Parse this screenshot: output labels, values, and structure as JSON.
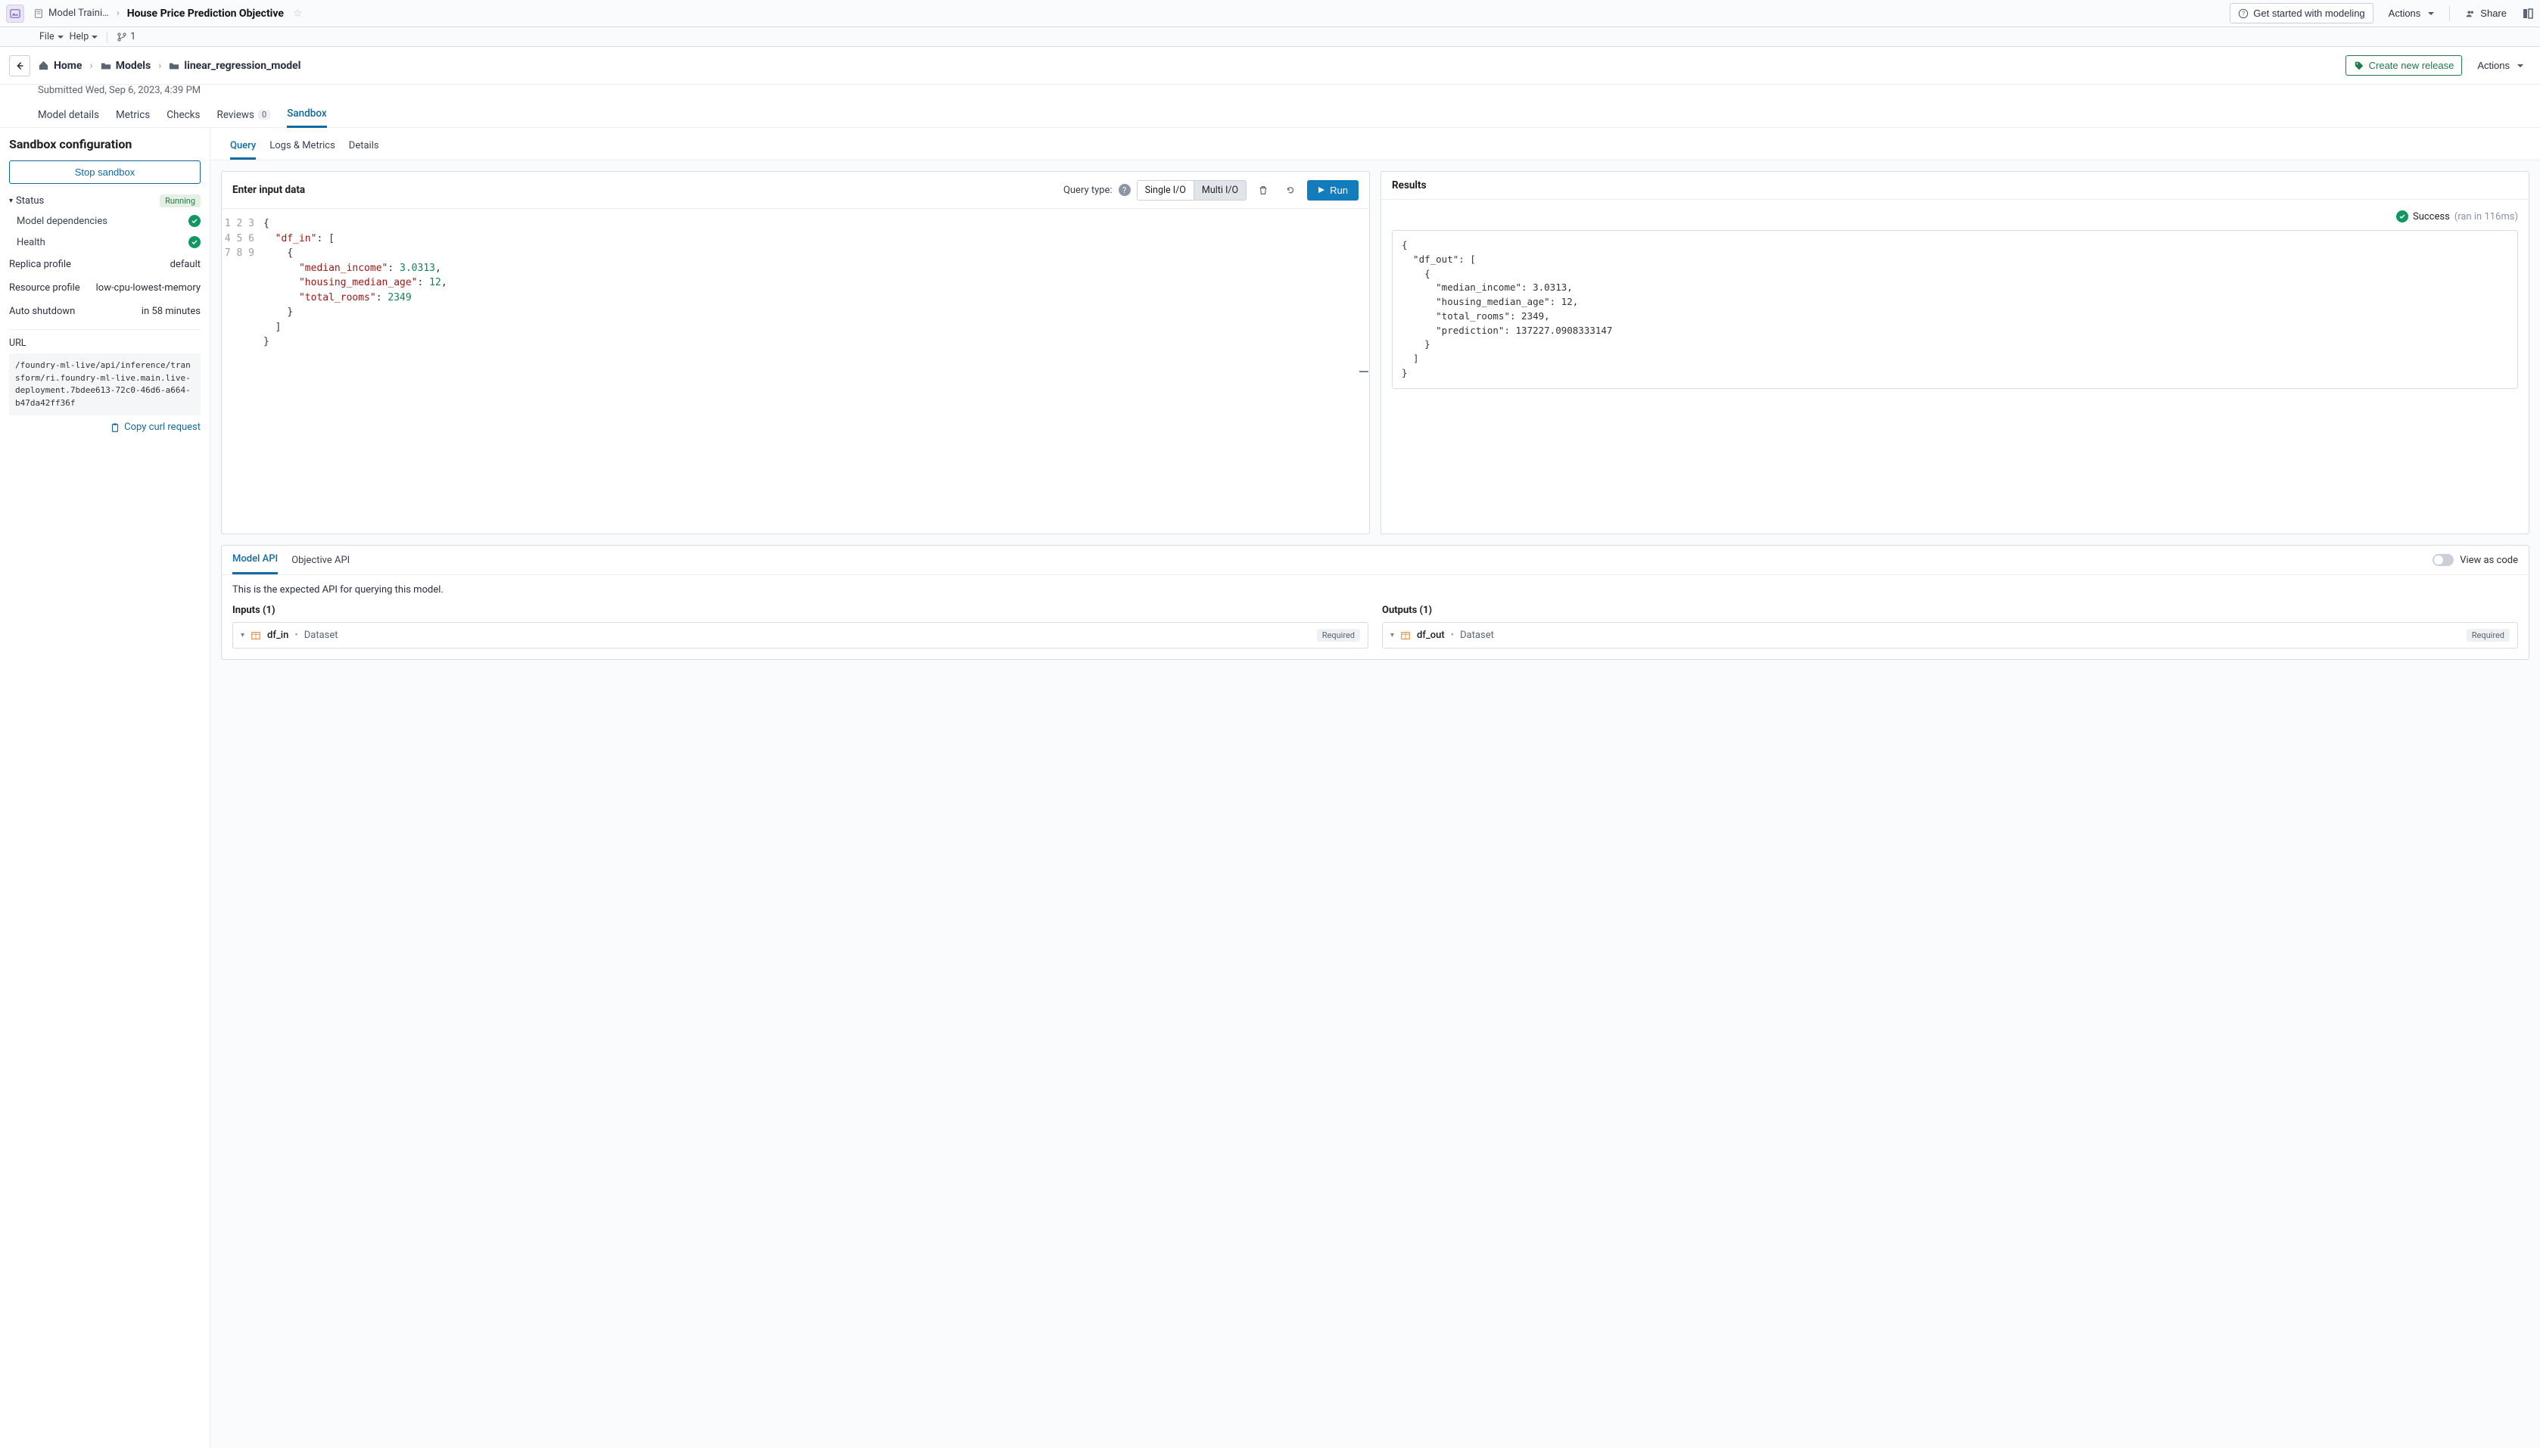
{
  "topbar": {
    "breadcrumb_parent": "Model Traini…",
    "page_title": "House Price Prediction Objective",
    "get_started": "Get started with modeling",
    "actions": "Actions",
    "share": "Share"
  },
  "menubar": {
    "file": "File",
    "help": "Help",
    "branch_count": "1"
  },
  "nav": {
    "home": "Home",
    "models": "Models",
    "current": "linear_regression_model",
    "create_release": "Create new release",
    "actions": "Actions"
  },
  "subline": "Submitted Wed, Sep 6, 2023, 4:39 PM",
  "tabs": {
    "model_details": "Model details",
    "metrics": "Metrics",
    "checks": "Checks",
    "reviews": "Reviews",
    "reviews_count": "0",
    "sandbox": "Sandbox"
  },
  "sidebar": {
    "title": "Sandbox configuration",
    "stop": "Stop sandbox",
    "status_label": "Status",
    "status_value": "Running",
    "model_deps": "Model dependencies",
    "health": "Health",
    "replica_profile_k": "Replica profile",
    "replica_profile_v": "default",
    "resource_profile_k": "Resource profile",
    "resource_profile_v": "low-cpu-lowest-memory",
    "auto_shutdown_k": "Auto shutdown",
    "auto_shutdown_v": "in 58 minutes",
    "url_label": "URL",
    "url_value": "/foundry-ml-live/api/inference/transform/ri.foundry-ml-live.main.live-deployment.7bdee613-72c0-46d6-a664-b47da42ff36f",
    "copy_curl": "Copy curl request"
  },
  "query_tabs": {
    "query": "Query",
    "logs": "Logs & Metrics",
    "details": "Details"
  },
  "input_panel": {
    "title": "Enter input data",
    "query_type_label": "Query type:",
    "single": "Single I/O",
    "multi": "Multi I/O",
    "run": "Run",
    "lines": [
      "1",
      "2",
      "3",
      "4",
      "5",
      "6",
      "7",
      "8",
      "9"
    ],
    "code": {
      "l1": "{",
      "l2a": "\"df_in\"",
      "l2b": ": [",
      "l3": "{",
      "l4a": "\"median_income\"",
      "l4b": ": ",
      "l4c": "3.0313",
      "l4d": ",",
      "l5a": "\"housing_median_age\"",
      "l5b": ": ",
      "l5c": "12",
      "l5d": ",",
      "l6a": "\"total_rooms\"",
      "l6b": ": ",
      "l6c": "2349",
      "l7": "}",
      "l8": "]",
      "l9": "}"
    }
  },
  "results_panel": {
    "title": "Results",
    "success": "Success",
    "timing": "(ran in 116ms)",
    "output": "{\n  \"df_out\": [\n    {\n      \"median_income\": 3.0313,\n      \"housing_median_age\": 12,\n      \"total_rooms\": 2349,\n      \"prediction\": 137227.0908333147\n    }\n  ]\n}"
  },
  "api": {
    "model_api": "Model API",
    "objective_api": "Objective API",
    "view_as_code": "View as code",
    "desc": "This is the expected API for querying this model.",
    "inputs_title": "Inputs (1)",
    "outputs_title": "Outputs (1)",
    "input_name": "df_in",
    "output_name": "df_out",
    "dataset": "Dataset",
    "required": "Required"
  }
}
